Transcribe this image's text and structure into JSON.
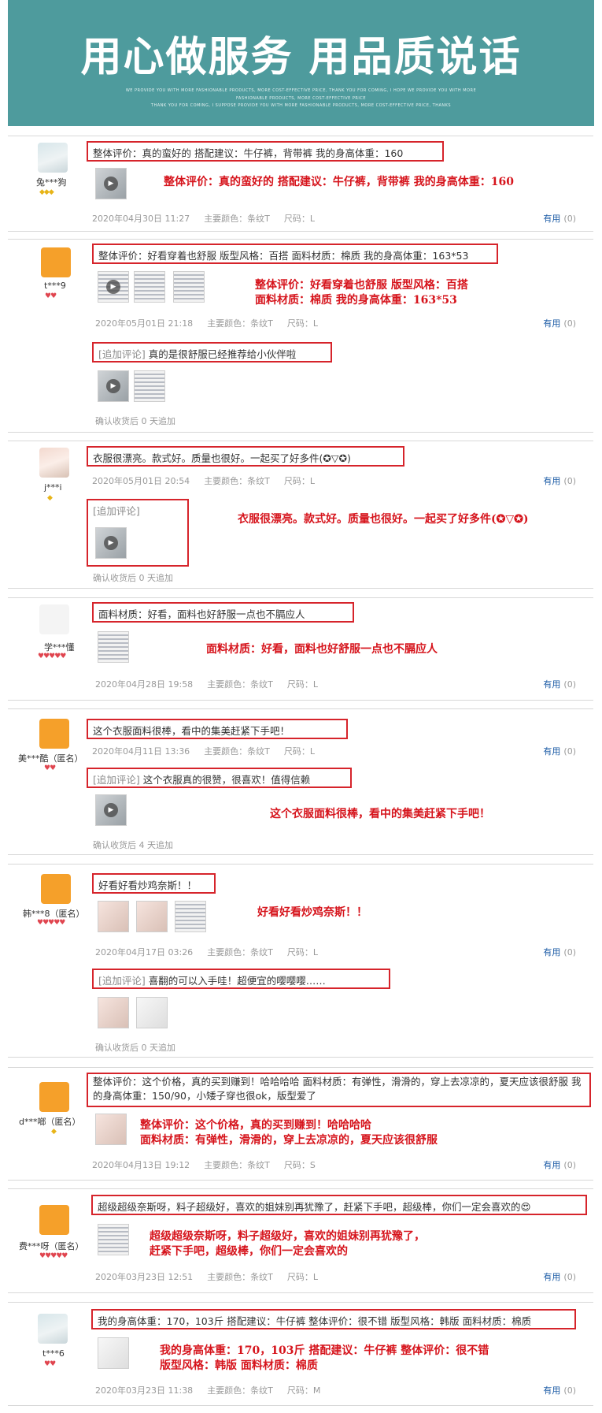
{
  "banner": {
    "title": "用心做服务 用品质说话",
    "sub1": "WE PROVIDE YOU WITH MORE FASHIONABLE PRODUCTS, MORE COST-EFFECTIVE PRICE, THANK YOU FOR COMING, I HOPE WE PROVIDE YOU WITH MORE",
    "sub2": "FASHIONABLE PRODUCTS, MORE COST-EFFECTIVE PRICE",
    "sub3": "THANK YOU FOR COMING, I SUPPOSE PROVIDE YOU WITH MORE FASHIONABLE PRODUCTS, MORE COST-EFFECTIVE PRICE, THANKS"
  },
  "labels": {
    "useful": "有用",
    "zero": "(0)",
    "play": "▶",
    "append": "[追加评论]"
  },
  "reviews": [
    {
      "user": "兔***狗",
      "rank": "◆◆◆",
      "text": "整体评价：真的蛮好的 搭配建议：牛仔裤，背带裤 我的身高体重：160",
      "big": [
        "整体评价：真的蛮好的 搭配建议：牛仔裤，背带裤 我的身高体重：160"
      ],
      "time": "2020年04月30日 11:27",
      "color": "主要颜色：条纹T",
      "size": "尺码：L"
    },
    {
      "user": "t***9",
      "rank": "♥♥",
      "text": "整体评价：好看穿着也舒服 版型风格：百搭 面料材质：棉质 我的身高体重：163*53",
      "big": [
        "整体评价：好看穿着也舒服 版型风格：百搭",
        "面料材质：棉质 我的身高体重：163*53"
      ],
      "time": "2020年05月01日 21:18",
      "color": "主要颜色：条纹T",
      "size": "尺码：L",
      "append": "真的是很舒服已经推荐给小伙伴啦",
      "confirm": "确认收货后 0 天追加"
    },
    {
      "user": "j***i",
      "rank": "◆",
      "text": "衣服很漂亮。款式好。质量也很好。一起买了好多件(✪▽✪)",
      "big": [
        "衣服很漂亮。款式好。质量也很好。一起买了好多件(✪▽✪)"
      ],
      "time": "2020年05月01日 20:54",
      "color": "主要颜色：条纹T",
      "size": "尺码：L",
      "append": "",
      "confirm": "确认收货后 0 天追加"
    },
    {
      "user": "学***懂",
      "rank": "♥♥♥♥♥",
      "text": "面料材质：好看，面料也好舒服一点也不膈应人",
      "big": [
        "面料材质：好看，面料也好舒服一点也不膈应人"
      ],
      "time": "2020年04月28日 19:58",
      "color": "主要颜色：条纹T",
      "size": "尺码：L"
    },
    {
      "user": "美***酷（匿名）",
      "rank": "♥♥",
      "text": "这个衣服面料很棒，看中的集美赶紧下手吧！",
      "big": [
        "这个衣服面料很棒，看中的集美赶紧下手吧！"
      ],
      "time": "2020年04月11日 13:36",
      "color": "主要颜色：条纹T",
      "size": "尺码：L",
      "append": "这个衣服真的很赞，很喜欢！值得信赖",
      "confirm": "确认收货后 4 天追加"
    },
    {
      "user": "韩***8（匿名）",
      "rank": "♥♥♥♥♥",
      "text": "好看好看炒鸡奈斯！！",
      "big": [
        "好看好看炒鸡奈斯！！"
      ],
      "time": "2020年04月17日 03:26",
      "color": "主要颜色：条纹T",
      "size": "尺码：L",
      "append": "喜翻的可以入手哇！超便宜的嘤嘤嘤……",
      "confirm": "确认收货后 0 天追加"
    },
    {
      "user": "d***啷（匿名）",
      "rank": "◆",
      "text": "整体评价：这个价格，真的买到赚到！哈哈哈哈 面料材质：有弹性，滑滑的，穿上去凉凉的，夏天应该很舒服 我的身高体重：150/90，小矮子穿也很ok，版型爱了",
      "big": [
        "整体评价：这个价格，真的买到赚到！哈哈哈哈",
        "面料材质：有弹性，滑滑的，穿上去凉凉的，夏天应该很舒服"
      ],
      "time": "2020年04月13日 19:12",
      "color": "主要颜色：条纹T",
      "size": "尺码：S"
    },
    {
      "user": "费***呀（匿名）",
      "rank": "♥♥♥♥♥",
      "text": "超级超级奈斯呀，料子超级好，喜欢的姐妹别再犹豫了，赶紧下手吧，超级棒，你们一定会喜欢的😍",
      "big": [
        "超级超级奈斯呀，料子超级好，喜欢的姐妹别再犹豫了，",
        "赶紧下手吧，超级棒，你们一定会喜欢的"
      ],
      "time": "2020年03月23日 12:51",
      "color": "主要颜色：条纹T",
      "size": "尺码：L"
    },
    {
      "user": "t***6",
      "rank": "♥♥",
      "text": "我的身高体重：170，103斤 搭配建议：牛仔裤 整体评价：很不错 版型风格：韩版 面料材质：棉质",
      "big": [
        "我的身高体重：170，103斤 搭配建议：牛仔裤 整体评价：很不错",
        "版型风格：韩版 面料材质：棉质"
      ],
      "time": "2020年03月23日 11:38",
      "color": "主要颜色：条纹T",
      "size": "尺码：M"
    }
  ]
}
